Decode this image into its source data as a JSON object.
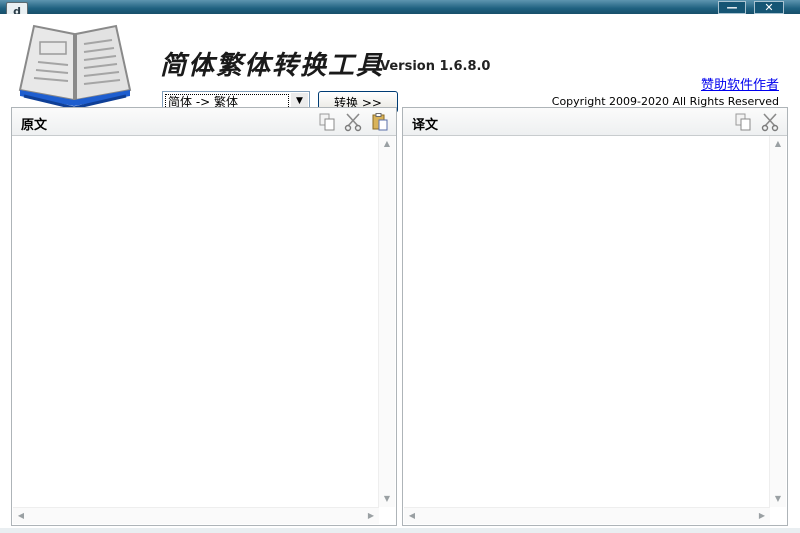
{
  "window": {
    "minimize_label": "—",
    "close_label": "✕"
  },
  "header": {
    "app_title": "简体繁体转换工具",
    "version": "Version 1.6.8.0",
    "donate_link": "赞助软件作者",
    "copyright": "Copyright 2009-2020 All Rights Reserved"
  },
  "controls": {
    "mode_selected": "简体 -> 繁体",
    "convert_button": "转换 >>"
  },
  "source_panel": {
    "title": "原文",
    "tools": [
      "copy-icon",
      "cut-icon",
      "paste-icon"
    ],
    "text": ""
  },
  "target_panel": {
    "title": "译文",
    "tools": [
      "copy-icon",
      "cut-icon"
    ],
    "text": ""
  },
  "colors": {
    "titlebar": "#1f6180",
    "link": "#0000ee",
    "panel_border": "#aeb4b8"
  }
}
